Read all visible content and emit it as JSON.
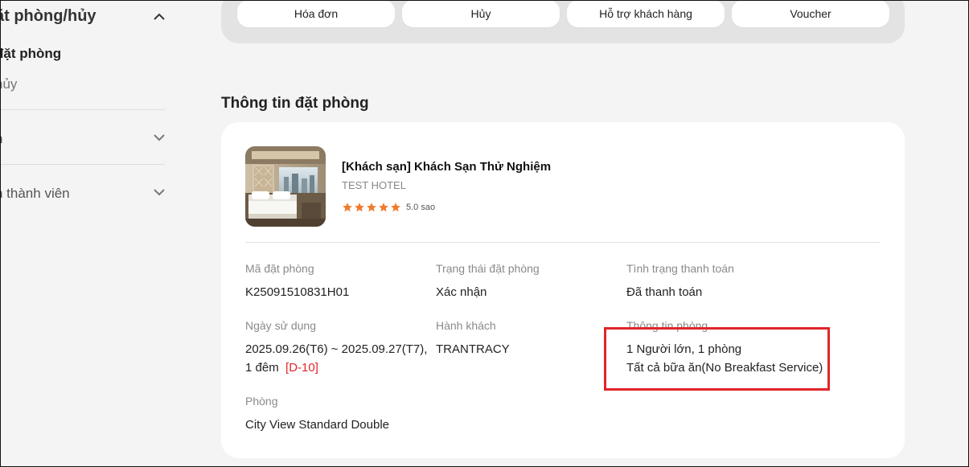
{
  "sidebar": {
    "title": "ặt phòng/hủy",
    "items": [
      {
        "label": "đặt phòng"
      },
      {
        "label": "hủy"
      },
      {
        "label": "h"
      },
      {
        "label": "n thành viên"
      }
    ]
  },
  "tabs": [
    "Hóa đơn",
    "Hủy",
    "Hỗ trợ khách hàng",
    "Voucher"
  ],
  "section_title": "Thông tin đặt phòng",
  "hotel": {
    "name": "[Khách sạn] Khách Sạn Thử Nghiệm",
    "name_en": "TEST HOTEL",
    "stars": 5,
    "rating_text": "5.0 sao",
    "star_color": "#f07a2a"
  },
  "details": {
    "booking_code_label": "Mã đặt phòng",
    "booking_code": "K25091510831H01",
    "booking_status_label": "Trạng thái đặt phòng",
    "booking_status": "Xác nhận",
    "payment_status_label": "Tình trạng thanh toán",
    "payment_status": "Đã thanh toán",
    "date_label": "Ngày sử dụng",
    "date_line1": "2025.09.26(T6) ~ 2025.09.27(T7),",
    "date_nights": "1 đêm",
    "date_countdown": "[D-10]",
    "guest_label": "Hành khách",
    "guest": "TRANTRACY",
    "room_info_label": "Thông tin phòng",
    "room_info_line1": "1 Người lớn, 1 phòng",
    "room_info_line2": "Tất cả bữa ăn(No Breakfast Service)",
    "room_label": "Phòng",
    "room": "City View Standard Double"
  },
  "colors": {
    "highlight": "#e1252a",
    "accent_red": "#e0262b"
  }
}
